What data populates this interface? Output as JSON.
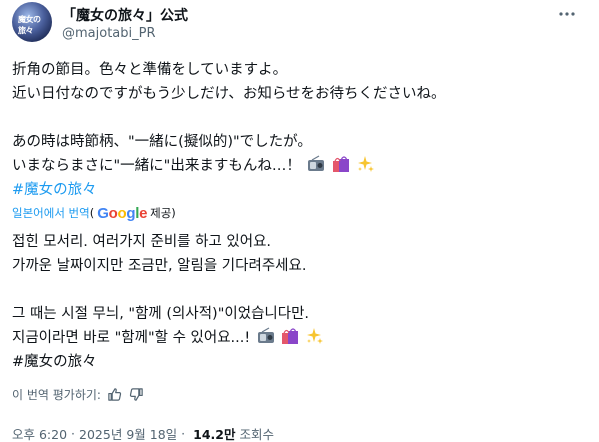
{
  "author": {
    "name": "「魔女の旅々」公式",
    "handle": "@majotabi_PR",
    "avatar_text": "魔女の旅々"
  },
  "original_text": {
    "line1": "折角の節目。色々と準備をしていますよ。",
    "line2": "近い日付なのですがもう少しだけ、お知らせをお待ちくださいね。",
    "line3": "あの時は時節柄、\"一緒に(擬似的)\"でしたが。",
    "line4": "いまならまさに\"一緒に\"出来ますもんね…！",
    "hashtag": "#魔女の旅々"
  },
  "translation": {
    "link": "일본어에서 번역",
    "paren_open": "(",
    "google_letters": [
      "G",
      "o",
      "o",
      "g",
      "l",
      "e"
    ],
    "provided": "제공)",
    "line1": "접힌 모서리. 여러가지 준비를 하고 있어요.",
    "line2": "가까운 날짜이지만 조금만, 알림을 기다려주세요.",
    "line3": "그 때는 시절 무늬, \"함께 (의사적)\"이었습니다만.",
    "line4": "지금이라면 바로 \"함께\"할 수 있어요...!",
    "hashtag": "#魔女の旅々"
  },
  "rate": {
    "label": "이 번역 평가하기:"
  },
  "meta": {
    "time": "오후 6:20",
    "separator": "·",
    "date": "2025년 9월 18일",
    "views_count": "14.2만",
    "views_label": "조회수"
  },
  "icons": {
    "more": "more-icon",
    "radio": "radio-emoji-icon",
    "bags": "shopping-bags-emoji-icon",
    "sparkles": "sparkles-emoji-icon",
    "thumbs_up": "thumbs-up-icon",
    "thumbs_down": "thumbs-down-icon"
  },
  "colors": {
    "link": "#1d9bf0",
    "secondary": "#536471",
    "text": "#0f1419"
  }
}
